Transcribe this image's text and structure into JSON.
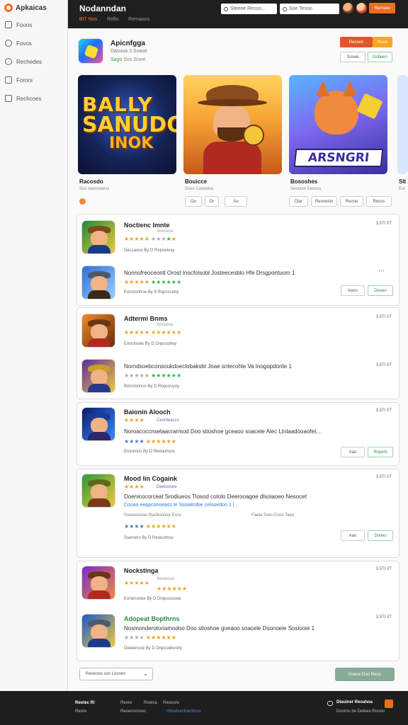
{
  "sidebar": {
    "brand": "Apkaicas",
    "items": [
      {
        "label": "Fooos",
        "icon": "home-icon"
      },
      {
        "label": "Fovos",
        "icon": "explore-icon"
      },
      {
        "label": "Rechedes",
        "icon": "library-icon"
      },
      {
        "label": "Forors",
        "icon": "downloads-icon"
      },
      {
        "label": "Rechcoes",
        "icon": "stats-icon"
      }
    ]
  },
  "header": {
    "title": "Nodanndan",
    "tabs": [
      "BIT Nos",
      "Rello",
      "Remaoos"
    ],
    "search1": "Steeoe Resso...",
    "search2": "Soe Tesoo",
    "cta": "Remsee"
  },
  "app": {
    "title": "Apicnfgga",
    "subtitle": "Dasuoa 3 Soase",
    "meta_green": "Sago",
    "meta_rest": "Sos  Sisee",
    "btn_primary": "Reosen",
    "btn_secondary": "Roon",
    "btn_green": "Dotieen",
    "btn_ghost": "Sosee"
  },
  "carousel": {
    "banner1_lines": [
      "BALLY",
      "SANUDON",
      "INOK"
    ],
    "banner3_text": "ARSNGRI",
    "captions": [
      {
        "title": "Racosdo",
        "sub": "Sos seersosess"
      },
      {
        "title": "Bouicce",
        "sub": "Ssoo Cooselse"
      },
      {
        "title": "Bososhes",
        "sub": "Seooioo Sesoss"
      },
      {
        "title": "Slt",
        "sub": "Eoi"
      }
    ],
    "chips": [
      "Oo",
      "Or",
      "Ao",
      "Dlar",
      "Reonesin",
      "Reone",
      "Reoss"
    ]
  },
  "list": {
    "rows": [
      {
        "title": "Noctienc Imnte",
        "sub": "Sorciese",
        "time": "3.5TI 0T",
        "dev": "Deccaoos By D Ropoeiusy"
      },
      {
        "title": "Nonnofreoceontl Orost Inocfolsobl Josteecesblo Hfe Drsgpontuom 1",
        "dev": "Eonctonhoe By 8 Ropcosohy",
        "btn1": "Ireoo",
        "btn2": "Deoeo"
      },
      {
        "title": "Adtermi Bnms",
        "sub": "Sorciese",
        "time": "3.5TI 0T",
        "dev": "Eonclosee By D Dnpcoshoy"
      },
      {
        "title": "Norndsoebconsoukdoeclobaksbt Joae sntecohle Va Inogopdonte 1",
        "time": "3.5TI 0T",
        "dev": "Bonctonnos By D Ropcouyoy"
      },
      {
        "title": "Baionin Alooch",
        "sub": "Ceonteaccs",
        "time": "3.5TI 0T",
        "long": "Noroacoccnsetaacrarmod Doo stioshoe gceaoo soacele Alec Ltnlaadooaofet...",
        "dev": "Etonenco By D Reoouhsss",
        "btn1": "Aao",
        "btn2": "Ropem"
      },
      {
        "title": "Mood lin Cogaink",
        "sub": "Deeioosee",
        "time": "3.5TI 0T",
        "long": "Doenicocorceat Srodiueos Tlosod cotolo Deerooagoe dlsoiaoeo Nesocet",
        "blue": "Cooao eeppconoeass le Ssoiatcdse celooedoo 1 l...",
        "tag1": "Ssoeosssse Stacbooose Esns",
        "tag2": "Faeta Sses Evoo Taeo",
        "dev": "Ssenono By D Reoouhsss",
        "btn1": "Aao",
        "btn2": "Dotieo"
      },
      {
        "title": "Nockstinga",
        "sub": "Seooioso",
        "time": "3.5TI 0T",
        "dev": "Eonenonoe By D Dnpcossooe"
      },
      {
        "title": "Adopeat Bopthrns",
        "time": "3.5TI 0T",
        "long": "Nosmonderotoriamodoo Doo stioshoe goeaoo soacele Dsonoeie Sosiooie 1",
        "dev": "Deteencoe By D Dnpcoebeshy"
      }
    ]
  },
  "controls": {
    "sort": "Reoeose sos Loooes",
    "load_more": "Doese Don Reoo"
  },
  "footer": {
    "col1_title": "Reotec Rl",
    "col1_items": [
      "Reore"
    ],
    "col2_title": "Reore",
    "col3_title": "Rnelca",
    "col3_items": [
      "Reoecoossoc"
    ],
    "col4_title": "Reooore",
    "col4_items": [
      "Hdcelsenlnecttoss"
    ],
    "chat": "Dlauiner Reoahoa",
    "right_sub": "Doorno be Deteeo Roooo"
  },
  "colors": {
    "accent": "#f06b1e",
    "star": "#f0a020",
    "green": "#2fb34a"
  }
}
